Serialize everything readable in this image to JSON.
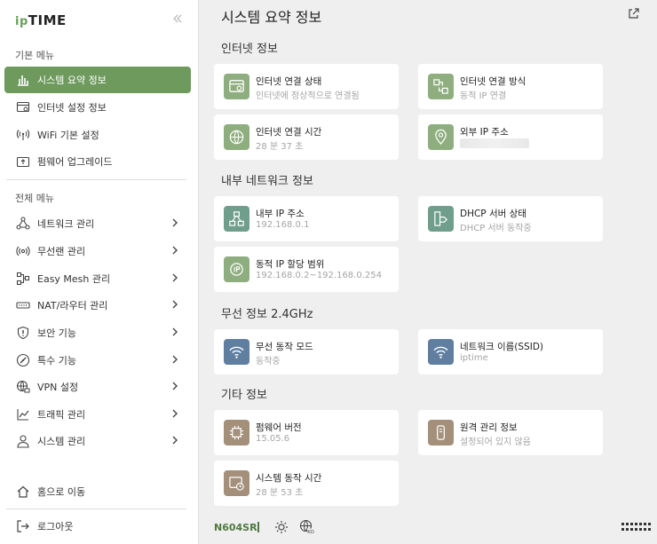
{
  "sidebar": {
    "logo_ip": "ip",
    "logo_time": "TIME",
    "basic_menu_label": "기본 메뉴",
    "basic_items": [
      {
        "label": "시스템 요약 정보",
        "icon": "bar-chart-icon"
      },
      {
        "label": "인터넷 설정 정보",
        "icon": "web-settings-icon"
      },
      {
        "label": "WiFi 기본 설정",
        "icon": "wifi-antenna-icon"
      },
      {
        "label": "펌웨어 업그레이드",
        "icon": "firmware-upgrade-icon"
      }
    ],
    "full_menu_label": "전체 메뉴",
    "full_items": [
      {
        "label": "네트워크 관리",
        "icon": "network-icon"
      },
      {
        "label": "무선랜 관리",
        "icon": "wireless-icon"
      },
      {
        "label": "Easy Mesh 관리",
        "icon": "mesh-icon"
      },
      {
        "label": "NAT/라우터 관리",
        "icon": "router-icon"
      },
      {
        "label": "보안 기능",
        "icon": "shield-icon"
      },
      {
        "label": "특수 기능",
        "icon": "gauge-icon"
      },
      {
        "label": "VPN 설정",
        "icon": "vpn-globe-icon"
      },
      {
        "label": "트래픽 관리",
        "icon": "traffic-chart-icon"
      },
      {
        "label": "시스템 관리",
        "icon": "admin-user-icon"
      }
    ],
    "home_label": "홈으로 이동",
    "logout_label": "로그아웃"
  },
  "main": {
    "title": "시스템 요약 정보",
    "sections": {
      "internet": {
        "title": "인터넷 정보",
        "cards": [
          {
            "label": "인터넷 연결 상태",
            "value": "인터넷에 정상적으로 연결됨"
          },
          {
            "label": "인터넷 연결 방식",
            "value": "동적 IP 연결"
          },
          {
            "label": "인터넷 연결 시간",
            "value": "28 분 37 초"
          },
          {
            "label": "외부 IP 주소",
            "value": ""
          }
        ]
      },
      "lan": {
        "title": "내부 네트워크 정보",
        "cards": [
          {
            "label": "내부 IP 주소",
            "value": "192.168.0.1"
          },
          {
            "label": "DHCP 서버 상태",
            "value": "DHCP 서버 동작중"
          },
          {
            "label": "동적 IP 할당 범위",
            "value": "192.168.0.2~192.168.0.254"
          }
        ]
      },
      "wireless": {
        "title": "무선 정보 2.4GHz",
        "cards": [
          {
            "label": "무선 동작 모드",
            "value": "동작중"
          },
          {
            "label": "네트워크 이름(SSID)",
            "value": "iptime"
          }
        ]
      },
      "other": {
        "title": "기타 정보",
        "cards": [
          {
            "label": "펌웨어 버전",
            "value": "15.05.6"
          },
          {
            "label": "원격 관리 정보",
            "value": "설정되어 있지 않음"
          },
          {
            "label": "시스템 동작 시간",
            "value": "28 분 53 초"
          }
        ]
      }
    }
  },
  "footer": {
    "model": "N604SR",
    "lang_badge": "KO"
  },
  "colors": {
    "accent": "#6e9a5e",
    "green_icon": "#8fae7f",
    "teal_icon": "#6f9e8c",
    "blue_icon": "#5f7ea0",
    "brown_icon": "#a38f7a"
  }
}
